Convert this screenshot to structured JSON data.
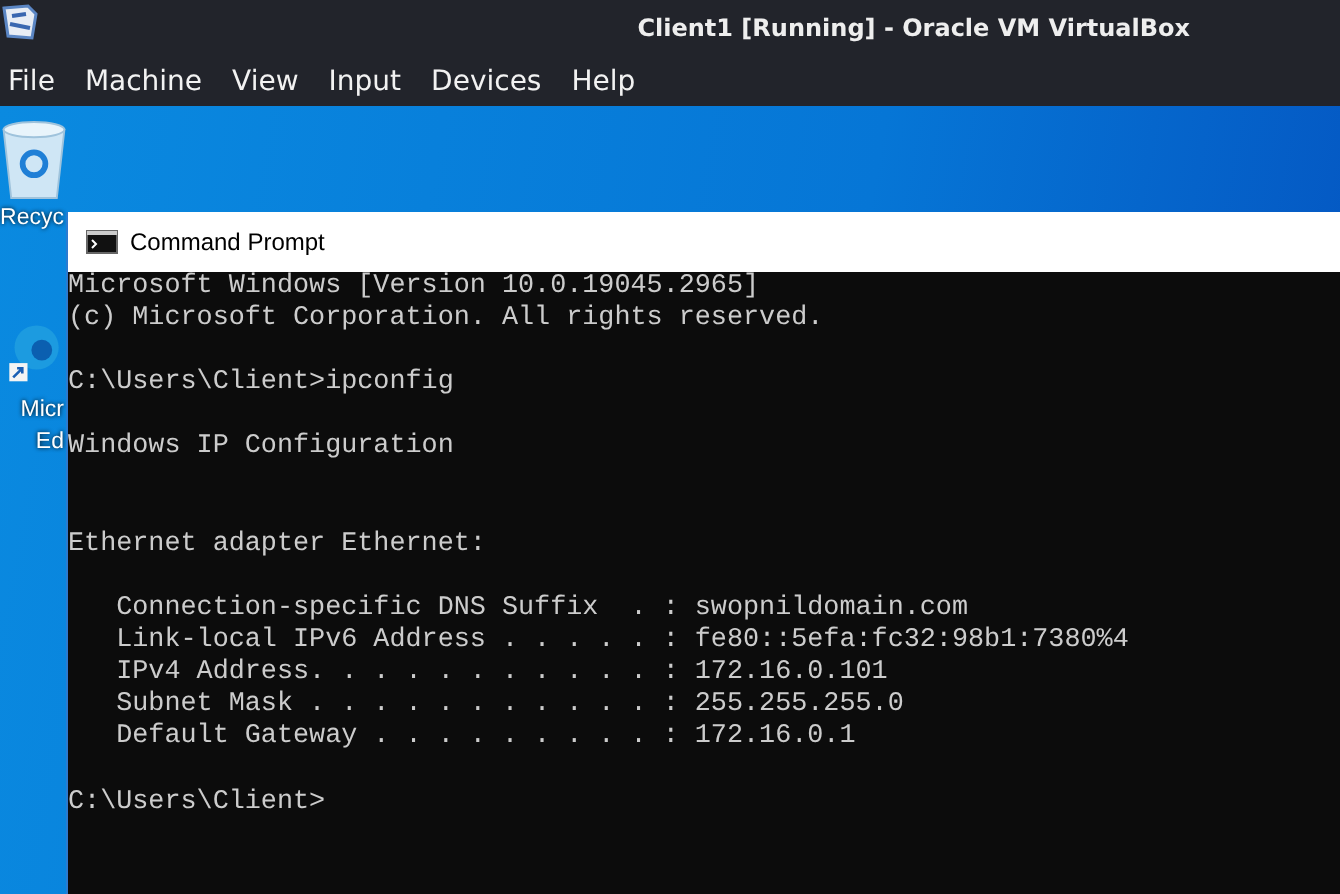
{
  "window": {
    "title": "Client1 [Running] - Oracle VM VirtualBox"
  },
  "menu": [
    "File",
    "Machine",
    "View",
    "Input",
    "Devices",
    "Help"
  ],
  "desktop_icons": [
    {
      "kind": "recycle-bin",
      "label": "Recyc"
    },
    {
      "kind": "browser",
      "label": "Micr\nEd"
    }
  ],
  "command_prompt": {
    "title": "Command Prompt",
    "lines": [
      {
        "kind": "text",
        "text": "Microsoft Windows [Version 10.0.19045.2965]"
      },
      {
        "kind": "text",
        "text": "(c) Microsoft Corporation. All rights reserved."
      },
      {
        "kind": "blank"
      },
      {
        "kind": "text",
        "text": "C:\\Users\\Client>ipconfig"
      },
      {
        "kind": "blank"
      },
      {
        "kind": "text",
        "text": "Windows IP Configuration"
      },
      {
        "kind": "blank"
      },
      {
        "kind": "blank"
      },
      {
        "kind": "text",
        "text": "Ethernet adapter Ethernet:"
      },
      {
        "kind": "blank"
      },
      {
        "kind": "text",
        "text": "   Connection-specific DNS Suffix  . : swopnildomain.com"
      },
      {
        "kind": "text",
        "text": "   Link-local IPv6 Address . . . . . : fe80::5efa:fc32:98b1:7380%4"
      },
      {
        "kind": "text",
        "text": "   IPv4 Address. . . . . . . . . . . : 172.16.0.101"
      },
      {
        "kind": "text",
        "text": "   Subnet Mask . . . . . . . . . . . : 255.255.255.0"
      },
      {
        "kind": "text",
        "text": "   Default Gateway . . . . . . . . . : 172.16.0.1"
      },
      {
        "kind": "blank"
      },
      {
        "kind": "text",
        "text": "C:\\Users\\Client>"
      }
    ]
  }
}
